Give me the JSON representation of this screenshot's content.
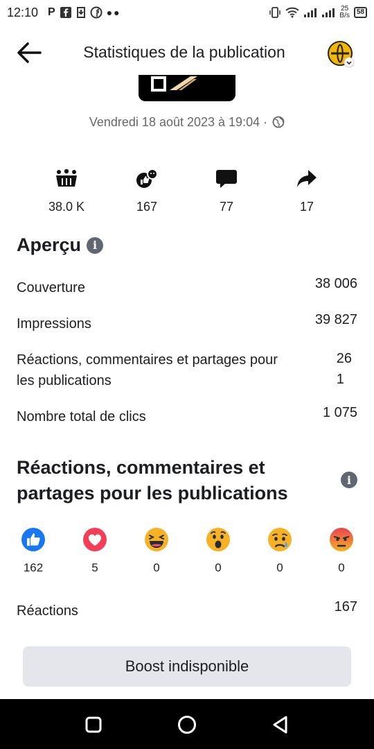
{
  "status_bar": {
    "time": "12:10",
    "left_letter": "P",
    "net_speed_top": "25",
    "net_speed_bottom": "B/s",
    "battery": "58"
  },
  "header": {
    "title": "Statistiques de la publication",
    "avatar_icon": "profile-avatar"
  },
  "post": {
    "date": "Vendredi 18 août 2023 à 19:04 ·",
    "privacy_icon": "globe-icon"
  },
  "summary": [
    {
      "icon": "reach-icon",
      "value": "38.0 K"
    },
    {
      "icon": "reactions-icon",
      "value": "167"
    },
    {
      "icon": "comment-icon",
      "value": "77"
    },
    {
      "icon": "share-icon",
      "value": "17"
    }
  ],
  "overview": {
    "title": "Aperçu",
    "metrics": [
      {
        "label": "Couverture",
        "value": "38 006"
      },
      {
        "label": "Impressions",
        "value": "39 827"
      },
      {
        "label_line1": "Réactions, commentaires et partages pour",
        "label_line2": "les publications",
        "value_line1": "26",
        "value_line2": "1"
      },
      {
        "label": "Nombre total de clics",
        "value": "1 075"
      }
    ]
  },
  "reactions_section": {
    "title_line1": "Réactions, commentaires et",
    "title_line2": "partages pour les publications",
    "reactions": [
      {
        "icon": "like-icon",
        "count": "162",
        "color": "#1877f2"
      },
      {
        "icon": "love-icon",
        "count": "5",
        "color": "#f33e58"
      },
      {
        "icon": "haha-icon",
        "count": "0",
        "color": "#f7b125"
      },
      {
        "icon": "wow-icon",
        "count": "0",
        "color": "#f7b125"
      },
      {
        "icon": "sad-icon",
        "count": "0",
        "color": "#f7b125"
      },
      {
        "icon": "angry-icon",
        "count": "0",
        "color": "#e9710f"
      }
    ],
    "total_label": "Réactions",
    "total_value": "167"
  },
  "boost_button": "Boost indisponible"
}
